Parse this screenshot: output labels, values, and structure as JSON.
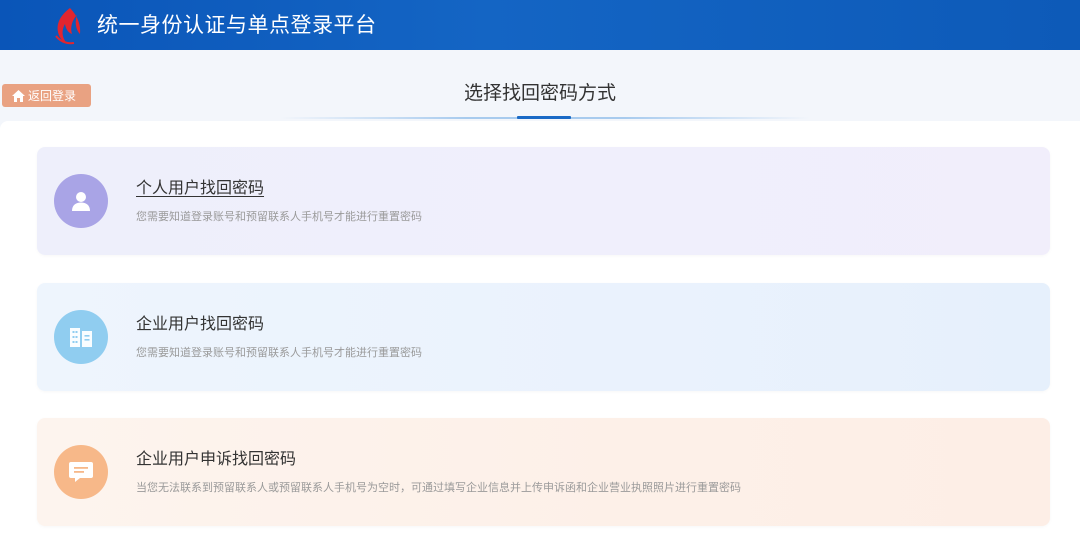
{
  "header": {
    "title": "统一身份认证与单点登录平台",
    "logo_icon": "flame-logo-icon"
  },
  "back_button": {
    "label": "返回登录",
    "icon": "home-icon",
    "color": "#e9a282"
  },
  "page": {
    "heading": "选择找回密码方式"
  },
  "options": [
    {
      "title": "个人用户找回密码",
      "description": "您需要知道登录账号和预留联系人手机号才能进行重置密码",
      "icon": "user-icon",
      "icon_color": "#a9a4e6"
    },
    {
      "title": "企业用户找回密码",
      "description": "您需要知道登录账号和预留联系人手机号才能进行重置密码",
      "icon": "building-icon",
      "icon_color": "#90cdf0"
    },
    {
      "title": "企业用户申诉找回密码",
      "description": "当您无法联系到预留联系人或预留联系人手机号为空时，可通过填写企业信息并上传申诉函和企业营业执照照片进行重置密码",
      "icon": "message-icon",
      "icon_color": "#f7b889"
    }
  ],
  "colors": {
    "header_blue": "#0a55b8",
    "accent_blue": "#1a6ac6"
  }
}
